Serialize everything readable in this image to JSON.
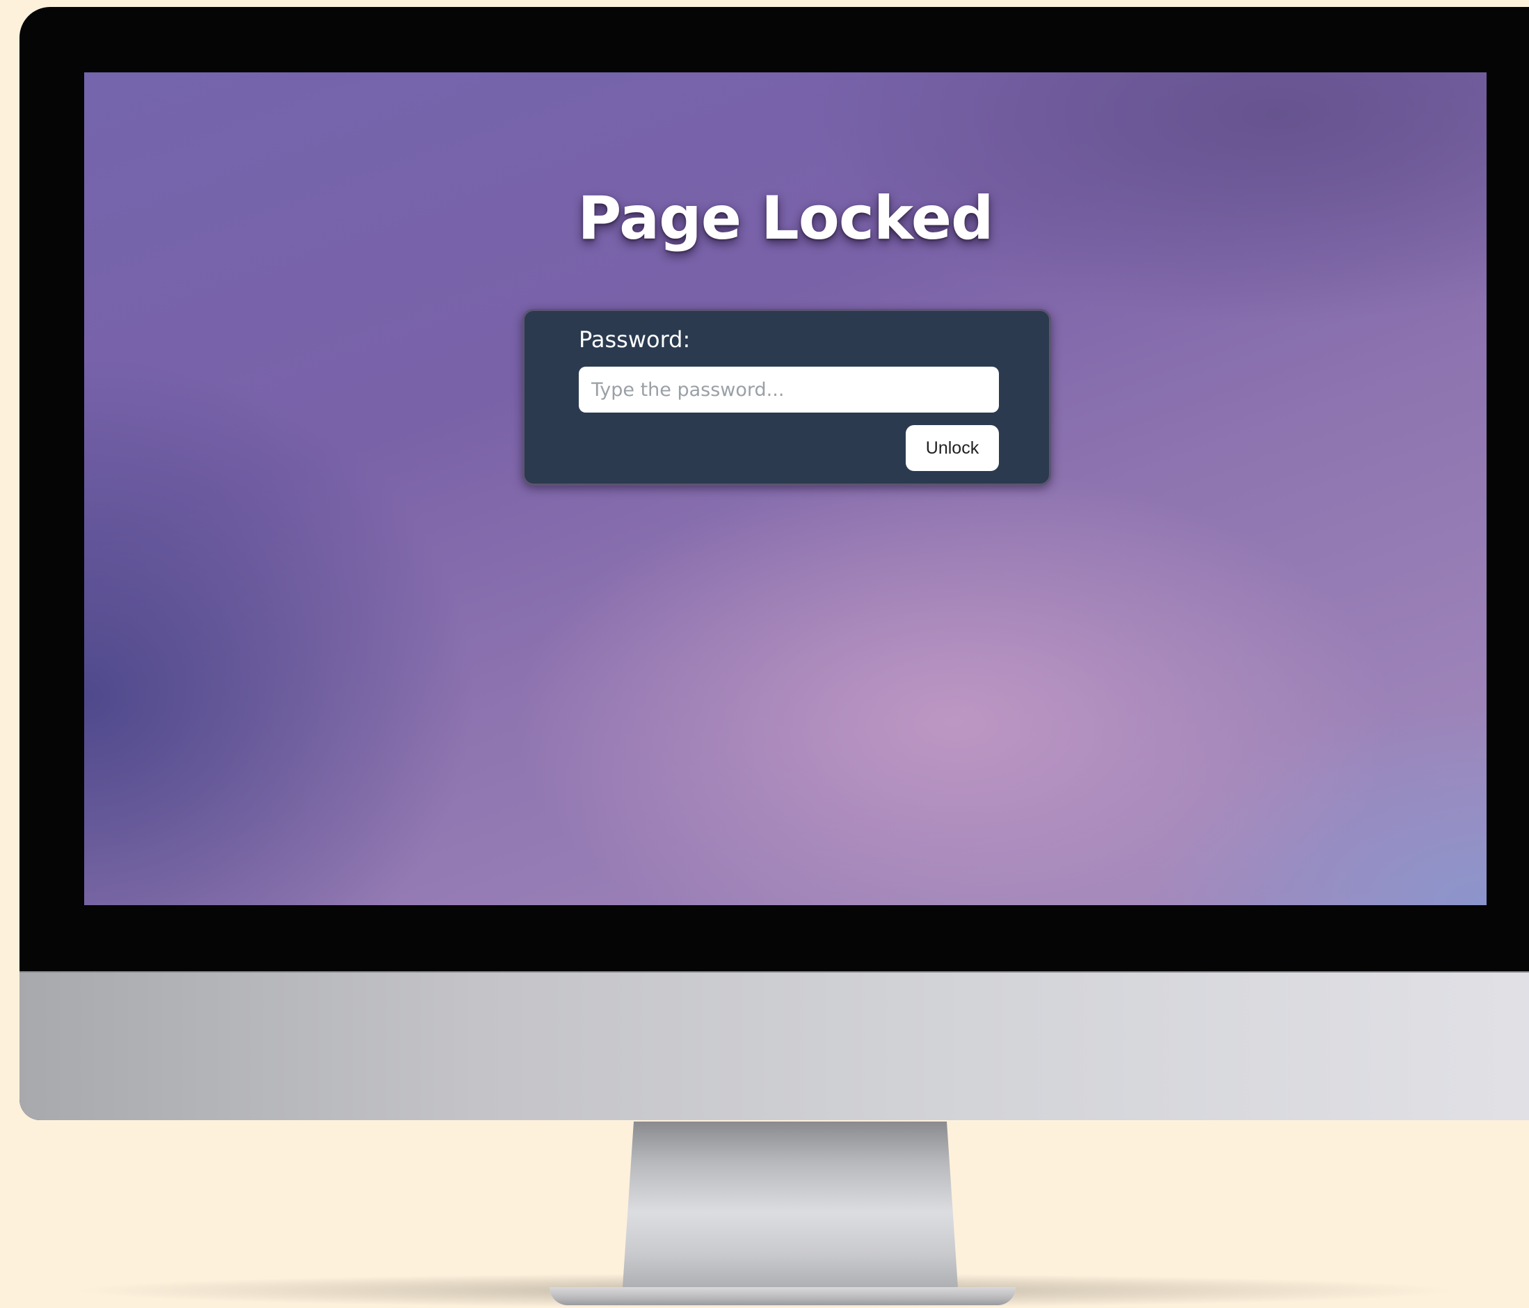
{
  "lock_screen": {
    "title": "Page Locked",
    "password_label": "Password:",
    "password_placeholder": "Type the password...",
    "unlock_label": "Unlock"
  },
  "colors": {
    "panel_background": "#2b3a4f",
    "screen_accent": "#7a62a8",
    "page_background": "#fdf1dc"
  }
}
